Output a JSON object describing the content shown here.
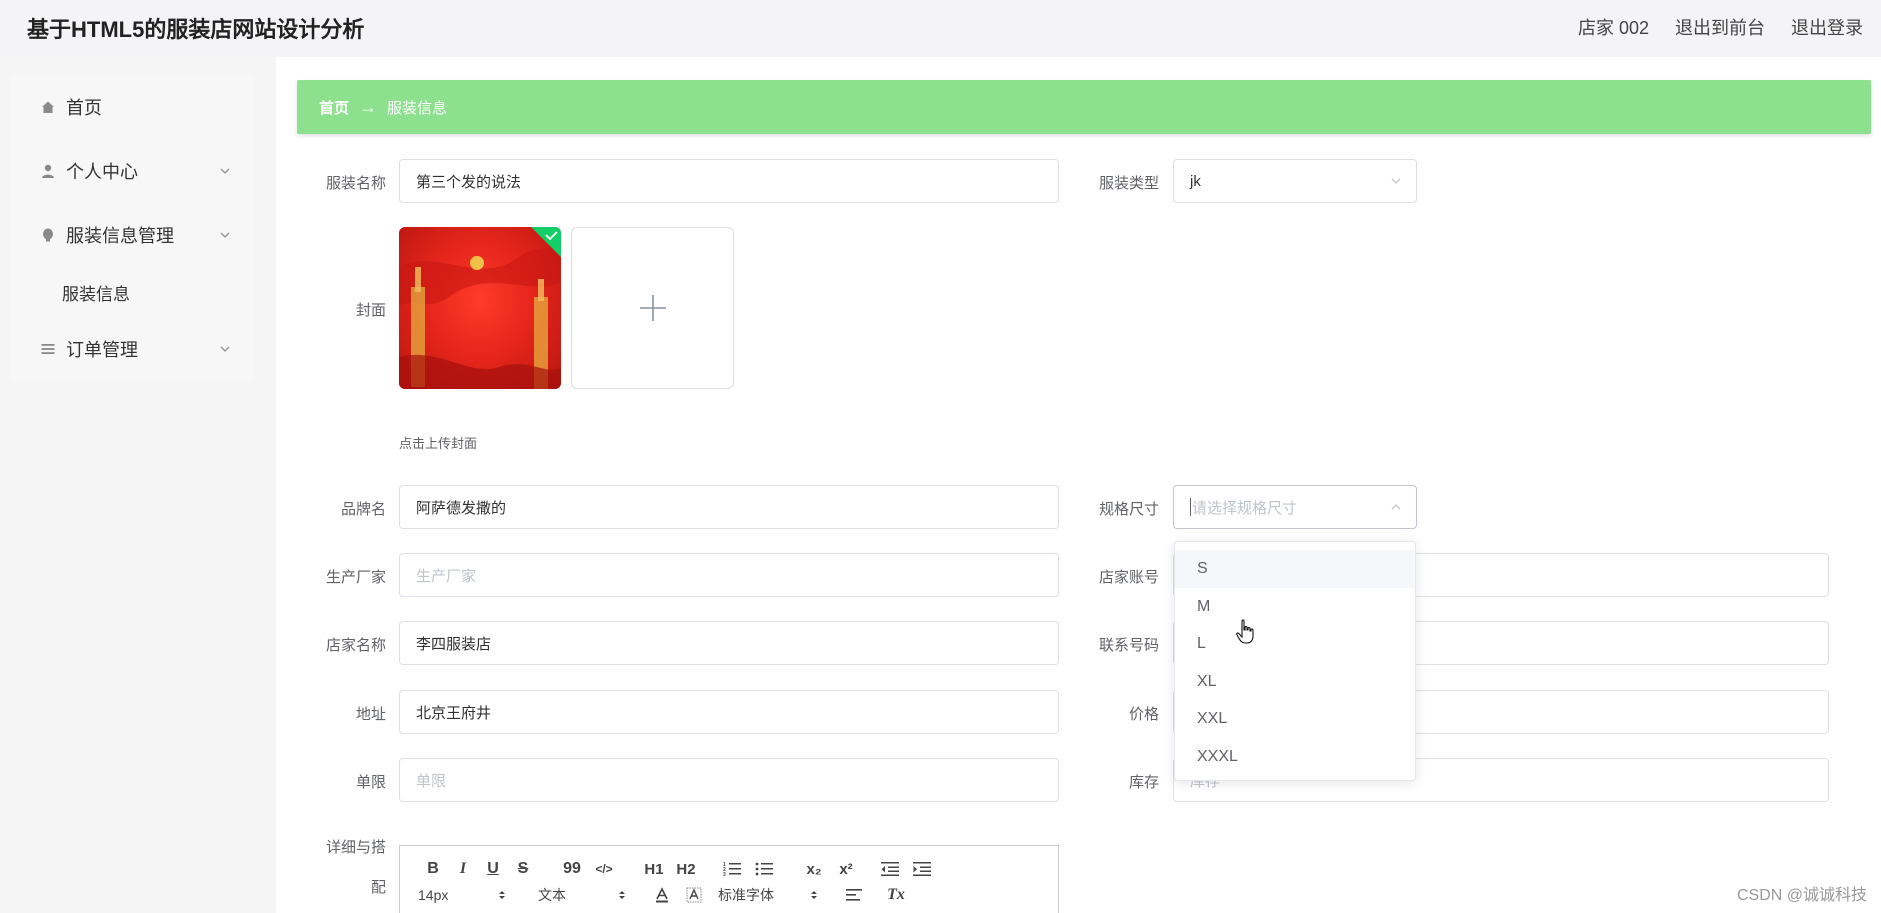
{
  "app": {
    "title": "基于HTML5的服装店网站设计分析"
  },
  "topnav": {
    "user": "店家 002",
    "to_front": "退出到前台",
    "logout": "退出登录"
  },
  "sidebar": {
    "items": [
      {
        "label": "首页",
        "icon": "home-icon"
      },
      {
        "label": "个人中心",
        "icon": "user-icon"
      },
      {
        "label": "服装信息管理",
        "icon": "bulb-icon"
      },
      {
        "label": "服装信息"
      },
      {
        "label": "订单管理",
        "icon": "menu-icon"
      }
    ]
  },
  "breadcrumb": {
    "home": "首页",
    "separator": "→",
    "current": "服装信息"
  },
  "form": {
    "name_label": "服装名称",
    "name_value": "第三个发的说法",
    "type_label": "服装类型",
    "type_value": "jk",
    "cover_label": "封面",
    "cover_tip": "点击上传封面",
    "brand_label": "品牌名",
    "brand_value": "阿萨德发撒的",
    "size_label": "规格尺寸",
    "size_placeholder": "请选择规格尺寸",
    "maker_label": "生产厂家",
    "maker_placeholder": "生产厂家",
    "shop_account_label": "店家账号",
    "shop_name_label": "店家名称",
    "shop_name_value": "李四服装店",
    "phone_label": "联系号码",
    "address_label": "地址",
    "address_value": "北京王府井",
    "price_label": "价格",
    "limit_label": "单限",
    "limit_placeholder": "单限",
    "stock_label": "库存",
    "stock_placeholder": "库存",
    "detail_label_1": "详细与搭",
    "detail_label_2": "配"
  },
  "dropdown": {
    "options": [
      "S",
      "M",
      "L",
      "XL",
      "XXL",
      "XXXL"
    ],
    "hovered": "S"
  },
  "editor": {
    "font_size": "14px",
    "text_type": "文本",
    "font_family": "标准字体",
    "buttons": {
      "bold": "B",
      "italic": "I",
      "underline": "U",
      "strike": "S",
      "quote": "99",
      "code": "</>",
      "h1": "H1",
      "h2": "H2",
      "sub": "x₂",
      "sup": "x²",
      "clear": "Tx"
    }
  },
  "watermark": "CSDN @诚诚科技",
  "colors": {
    "breadcrumb_bg": "#8ce08e",
    "success_badge": "#13ce66"
  }
}
